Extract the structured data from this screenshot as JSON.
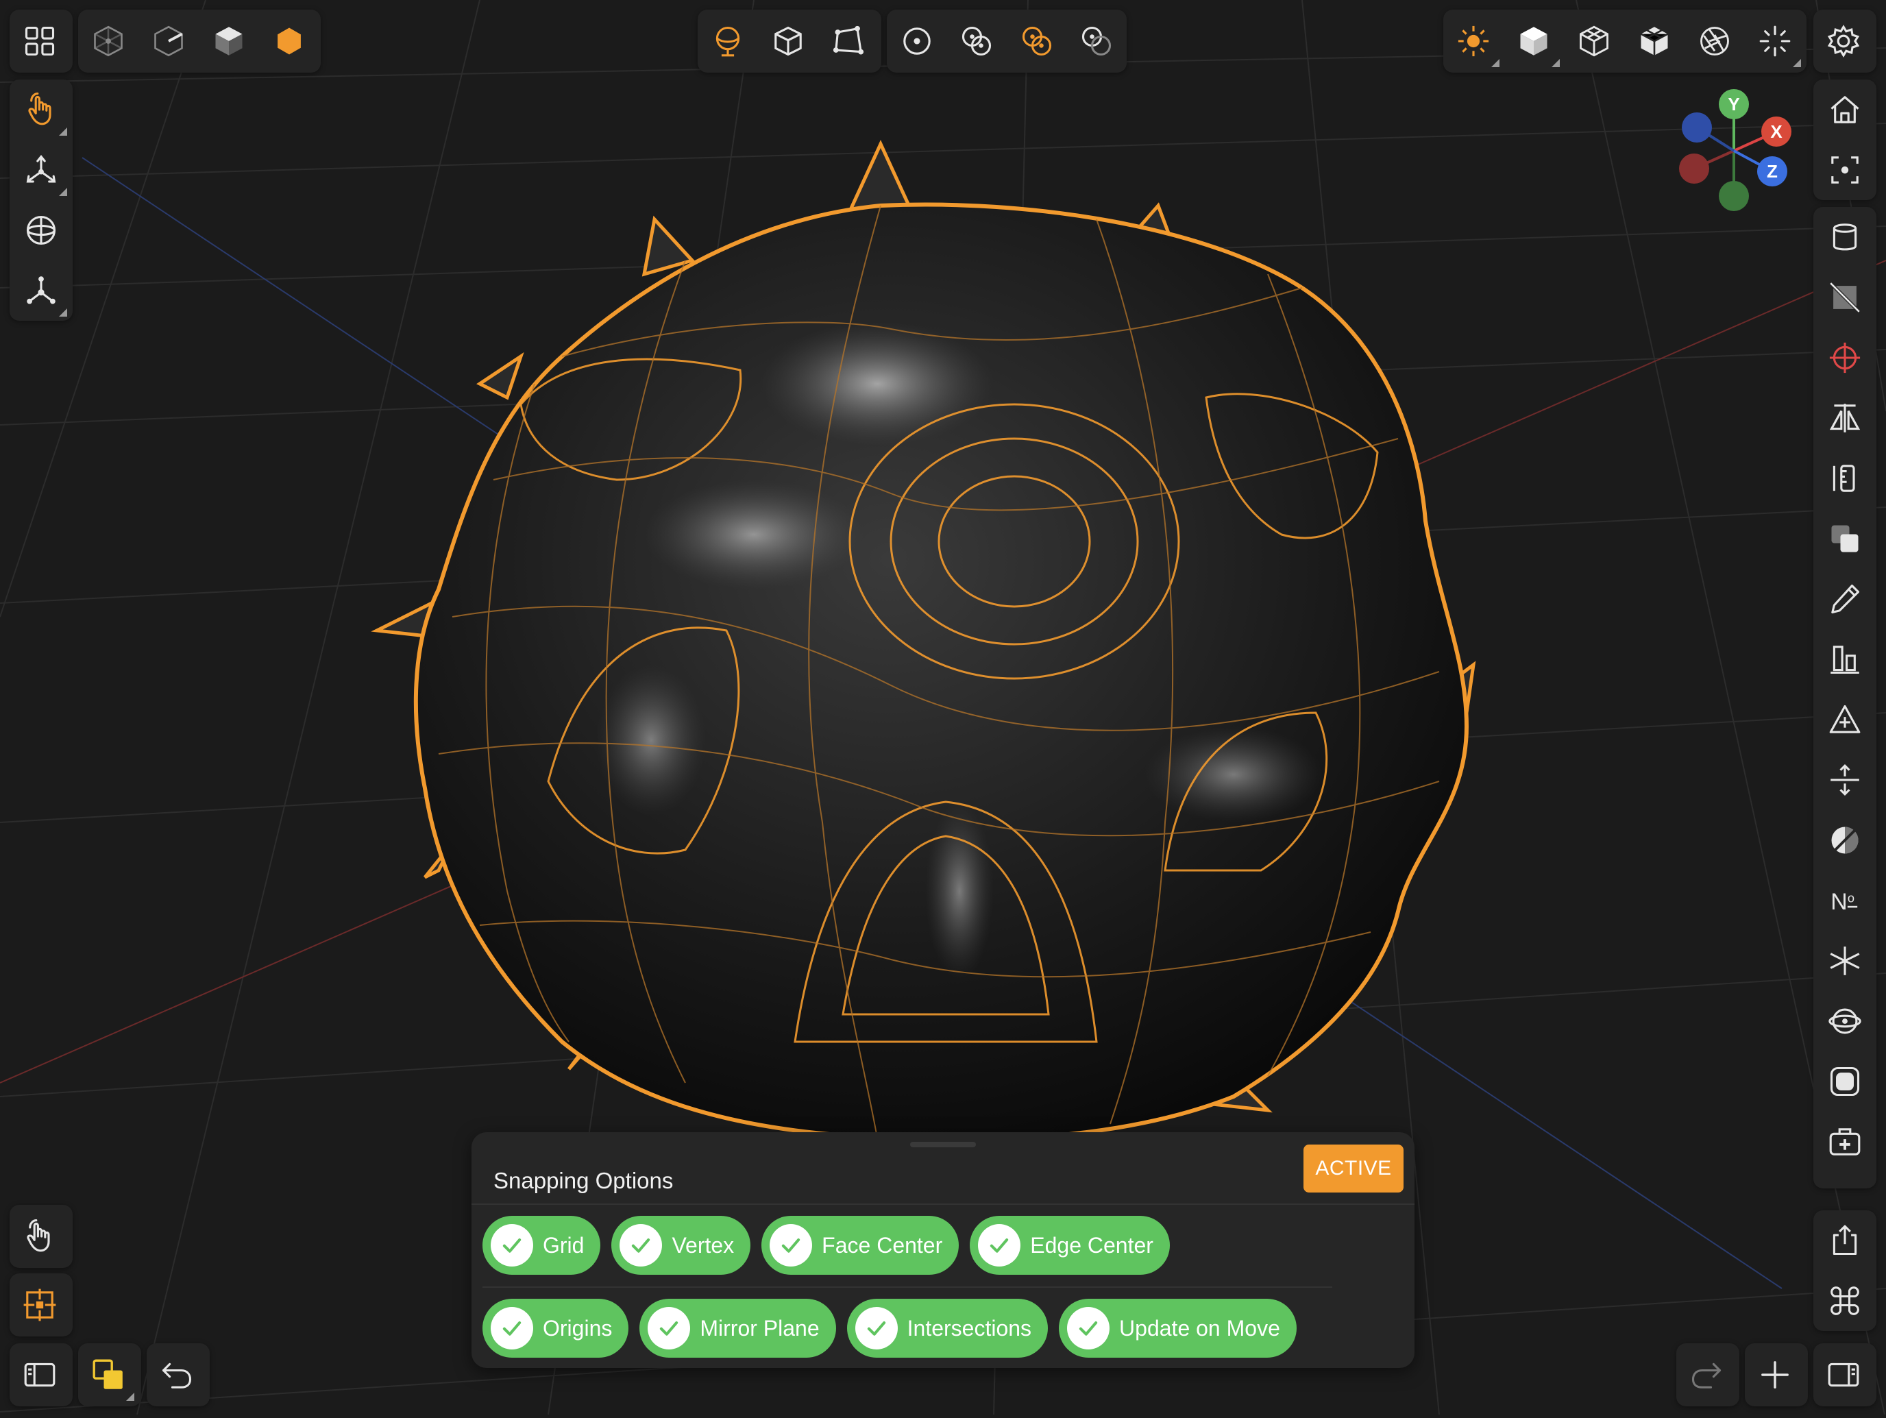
{
  "app": {
    "accent_color": "#f29a2e",
    "selection_color": "#f29a2e",
    "background_color": "#1b1b1b"
  },
  "top_left_toolbar": {
    "menu_icon": "grid-menu-icon",
    "view_modes": [
      "wireframe-cube-icon",
      "half-shaded-cube-icon",
      "solid-cube-icon",
      "filled-hexagon-icon"
    ]
  },
  "top_center_toolbar": {
    "select_tools": [
      "lasso-sphere-icon",
      "object-cube-icon",
      "polygon-select-icon"
    ],
    "pivot_tools": [
      "pivot-center-icon",
      "pivot-individual-icon",
      "pivot-group-icon",
      "pivot-cursor-icon"
    ]
  },
  "top_right_toolbar": {
    "tools": [
      "sun-icon",
      "solid-box-icon",
      "wireframe-box-icon",
      "xray-box-icon",
      "aperture-icon",
      "sparkle-icon"
    ],
    "settings_icon": "gear-icon"
  },
  "left_toolbar": {
    "tools": [
      "touch-hand-icon",
      "move-gizmo-icon",
      "sphere-icon",
      "axis-gizmo-icon"
    ]
  },
  "right_toolbar": {
    "tools": [
      "home-icon",
      "frame-selection-icon",
      "cylinder-icon",
      "hatched-square-icon",
      "crosshair-icon",
      "mirror-icon",
      "measure-icon",
      "overlap-squares-icon",
      "pen-icon",
      "align-icon",
      "add-triangle-icon",
      "push-pull-icon",
      "material-icon",
      "number-icon",
      "asterisk-icon",
      "orbit-icon",
      "rounded-square-icon",
      "first-aid-icon",
      "share-icon",
      "command-icon"
    ]
  },
  "gizmo": {
    "y_label": "Y",
    "x_label": "X",
    "z_label": "Z"
  },
  "bottom_left": {
    "tools": [
      "touch-icon",
      "snap-target-icon",
      "sidebar-left-icon",
      "overlap-copy-icon",
      "undo-icon"
    ]
  },
  "bottom_right": {
    "tools": [
      "redo-icon",
      "plus-icon",
      "sidebar-right-icon"
    ]
  },
  "snapping": {
    "title": "Snapping Options",
    "status": "ACTIVE",
    "row1": [
      {
        "label": "Grid",
        "checked": true
      },
      {
        "label": "Vertex",
        "checked": true
      },
      {
        "label": "Face Center",
        "checked": true
      },
      {
        "label": "Edge Center",
        "checked": true
      }
    ],
    "row2": [
      {
        "label": "Origins",
        "checked": true
      },
      {
        "label": "Mirror Plane",
        "checked": true
      },
      {
        "label": "Intersections",
        "checked": true
      },
      {
        "label": "Update on Move",
        "checked": true
      }
    ]
  }
}
